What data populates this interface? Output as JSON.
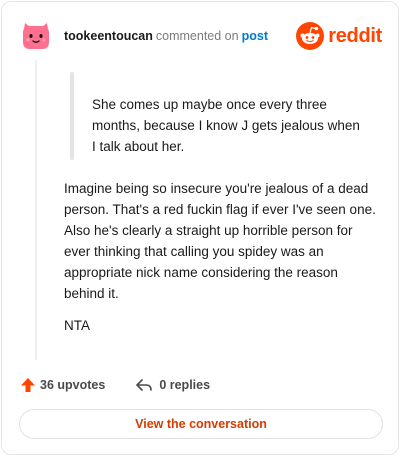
{
  "header": {
    "username": "tookeentoucan",
    "action": "commented on",
    "post_link": "post",
    "brand_name": "reddit"
  },
  "comment": {
    "quote": "She comes up maybe once every three months, because I know J gets jealous when I talk about her.",
    "body": "Imagine being so insecure you're jealous of a dead person. That's a red fuckin flag if ever I've seen one. Also he's clearly a straight up horrible person for ever thinking that calling you spidey was an appropriate nick name considering the reason behind it.",
    "verdict": "NTA"
  },
  "footer": {
    "upvotes": "36 upvotes",
    "replies": "0 replies",
    "cta_label": "View the conversation"
  },
  "colors": {
    "brand": "#ff4500",
    "avatar": "#ff6f8e",
    "link": "#0079d3",
    "cta_text": "#d93a00"
  },
  "icons": [
    "snoo-avatar-icon",
    "reddit-logo-icon",
    "upvote-arrow-icon",
    "reply-arrow-icon"
  ]
}
